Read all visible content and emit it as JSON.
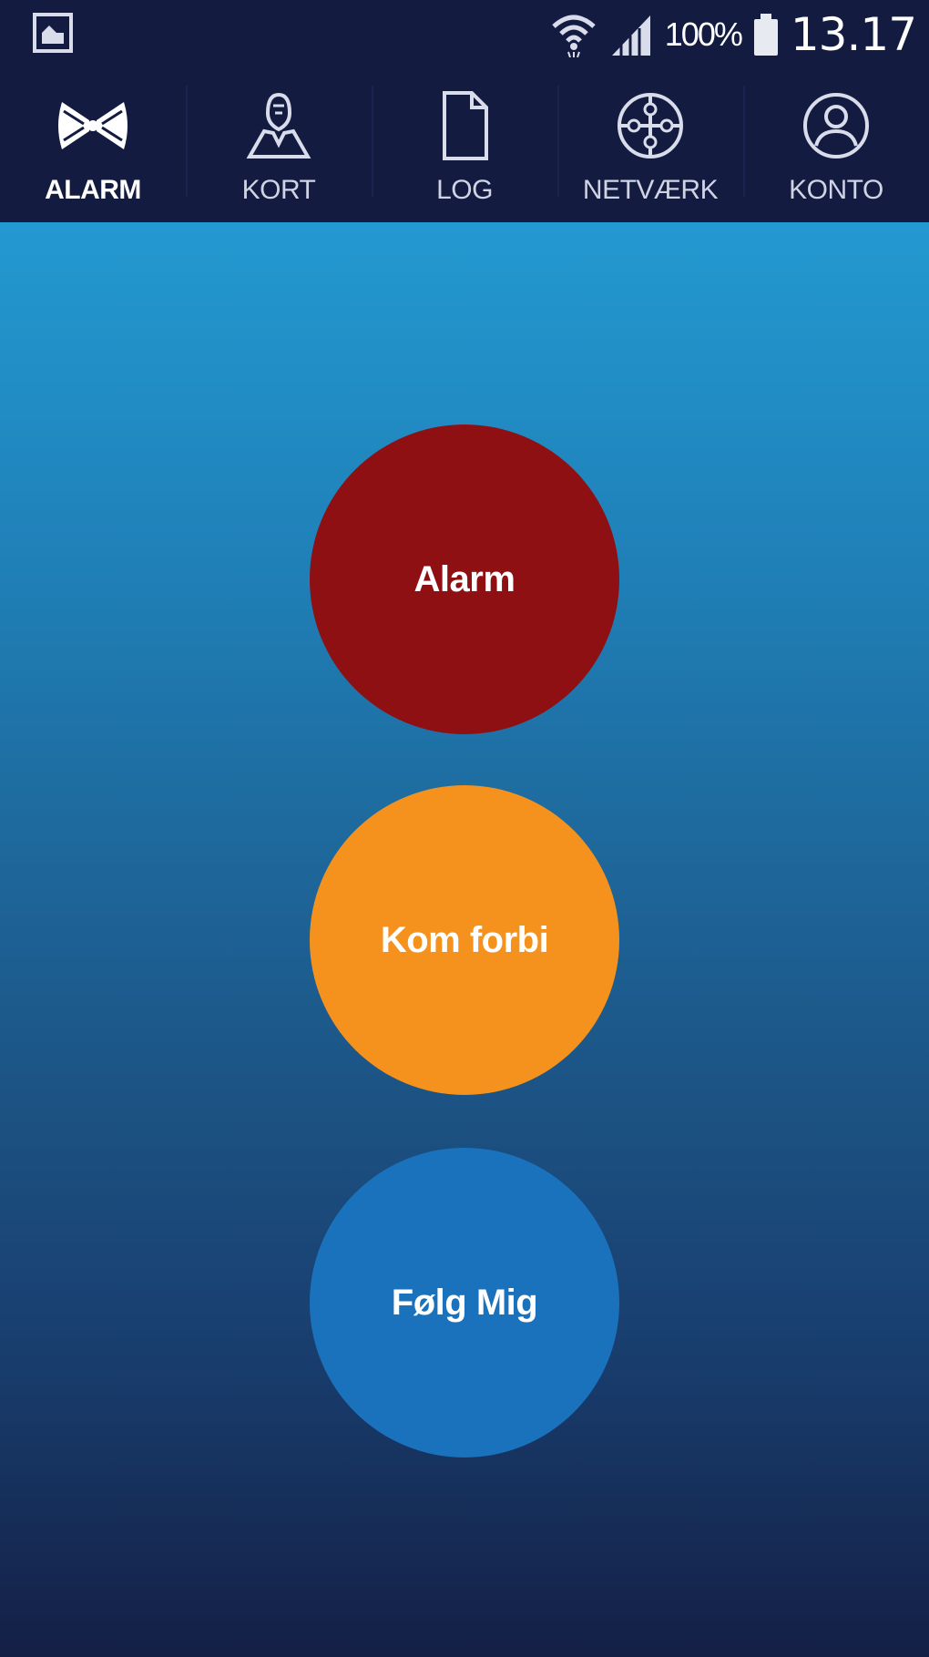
{
  "status_bar": {
    "battery_percent": "100%",
    "time": "13.17",
    "icons": [
      "gallery-icon",
      "wifi-icon",
      "signal-icon",
      "battery-icon"
    ]
  },
  "tabs": [
    {
      "label": "ALARM",
      "icon": "alarm-icon",
      "active": true
    },
    {
      "label": "KORT",
      "icon": "map-person-icon",
      "active": false
    },
    {
      "label": "LOG",
      "icon": "document-icon",
      "active": false
    },
    {
      "label": "NETVÆRK",
      "icon": "network-icon",
      "active": false
    },
    {
      "label": "KONTO",
      "icon": "account-icon",
      "active": false
    }
  ],
  "buttons": {
    "alarm": {
      "label": "Alarm",
      "color": "#8e1013"
    },
    "kom_forbi": {
      "label": "Kom forbi",
      "color": "#f5921e"
    },
    "folg_mig": {
      "label": "Følg Mig",
      "color": "#1b72bc"
    }
  },
  "colors": {
    "header_bg": "#131c40",
    "gradient_top": "#2399d1",
    "gradient_bottom": "#141f45"
  }
}
